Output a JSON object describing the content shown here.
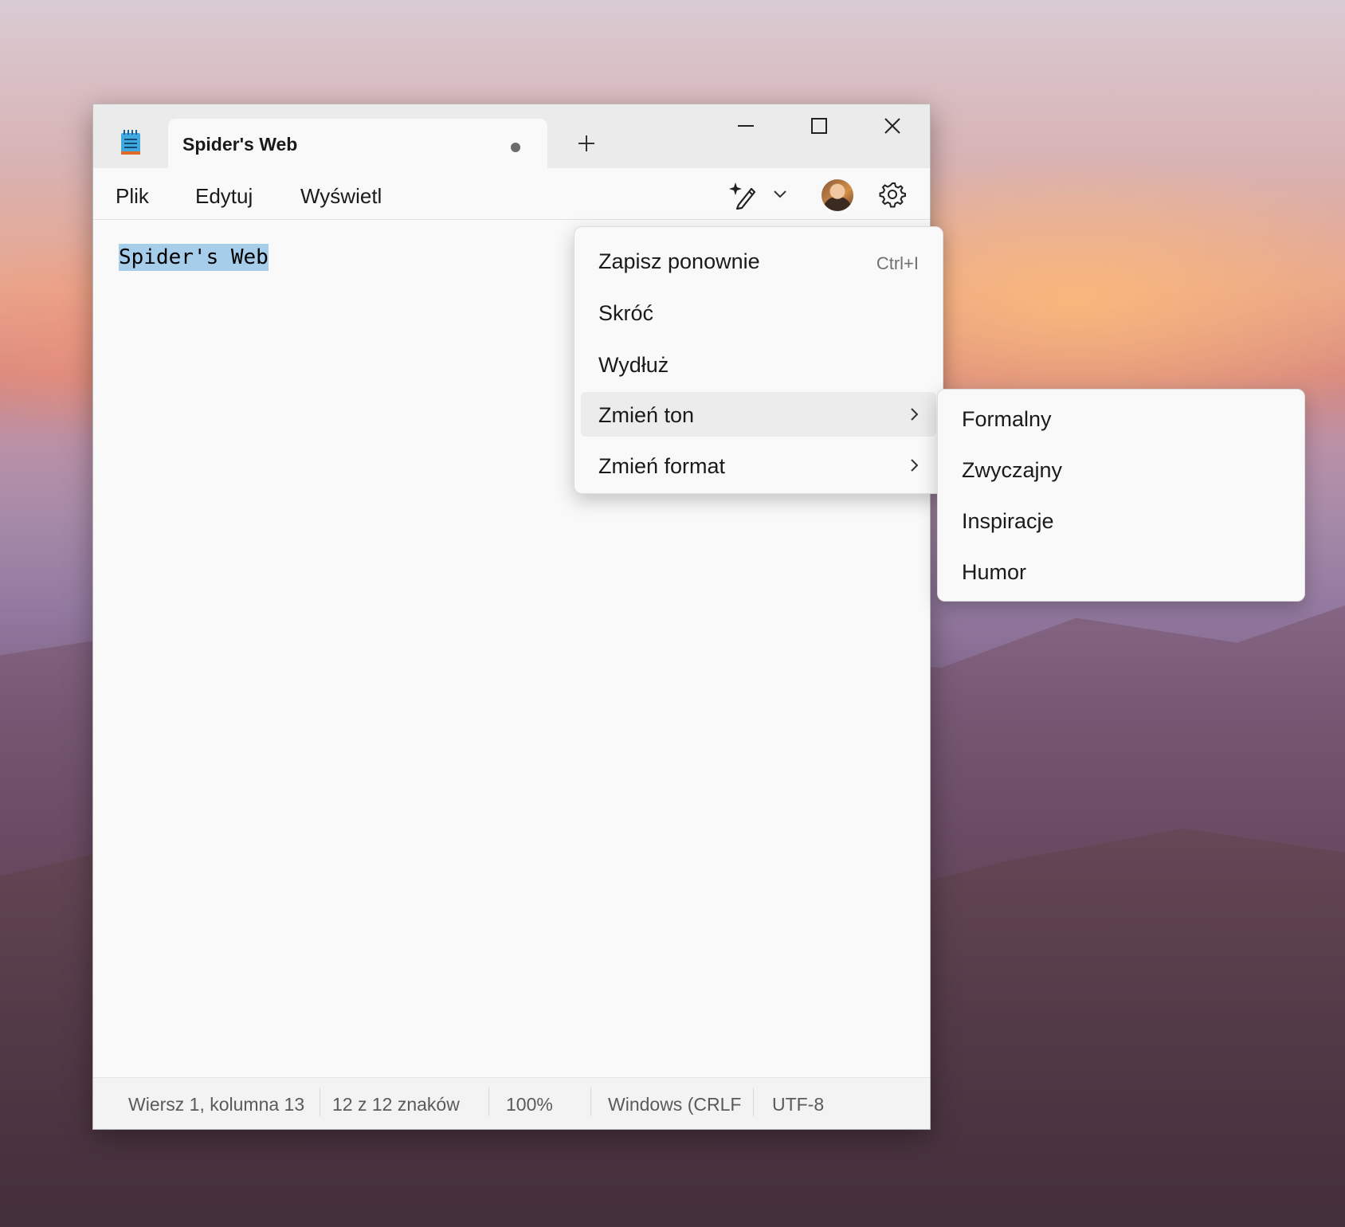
{
  "window": {
    "tab_title": "Spider's Web",
    "unsaved_indicator": "•"
  },
  "menubar": {
    "file": "Plik",
    "edit": "Edytuj",
    "view": "Wyświetl"
  },
  "toolbar_icons": [
    "copilot-rewrite-icon",
    "chevron-down-icon",
    "avatar",
    "gear-icon"
  ],
  "editor": {
    "content": "Spider's Web",
    "selection_color": "#a6cdea"
  },
  "context_menu": {
    "items": [
      {
        "label": "Zapisz ponownie",
        "shortcut": "Ctrl+I"
      },
      {
        "label": "Skróć"
      },
      {
        "label": "Wydłuż"
      },
      {
        "label": "Zmień ton",
        "submenu": true,
        "active": true
      },
      {
        "label": "Zmień format",
        "submenu": true
      }
    ]
  },
  "tone_submenu": {
    "items": [
      "Formalny",
      "Zwyczajny",
      "Inspiracje",
      "Humor"
    ]
  },
  "statusbar": {
    "position": "Wiersz 1, kolumna 13",
    "chars": "12 z 12 znaków",
    "zoom": "100%",
    "line_ending": "Windows (CRLF",
    "encoding": "UTF-8"
  }
}
